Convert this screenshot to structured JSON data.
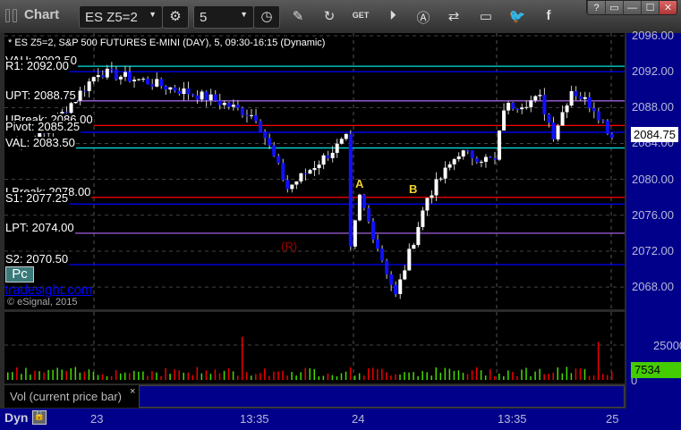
{
  "toolbar": {
    "title": "Chart",
    "symbol": "ES Z5=2",
    "interval": "5",
    "win_buttons": [
      "?",
      "▭",
      "—",
      "☐",
      "✕"
    ]
  },
  "chart": {
    "header": "* ES Z5=2, S&P 500 FUTURES E-MINI (DAY), 5, 09:30-16:15 (Dynamic)",
    "levels": [
      {
        "label": "VAH: 2092.50",
        "price": 2092.6,
        "color": "#00e5e5"
      },
      {
        "label": "R1: 2092.00",
        "price": 2092.0,
        "color": "#0000ff"
      },
      {
        "label": "UPT: 2088.75",
        "price": 2088.75,
        "color": "#a060e0"
      },
      {
        "label": "UBreak: 2086.00",
        "price": 2086.0,
        "color": "#ff0000"
      },
      {
        "label": "Pivot: 2085.25",
        "price": 2085.25,
        "color": "#0000ff"
      },
      {
        "label": "VAL: 2083.50",
        "price": 2083.5,
        "color": "#00e5e5"
      },
      {
        "label": "LBreak: 2078.00",
        "price": 2078.0,
        "color": "#ff0000"
      },
      {
        "label": "S1: 2077.25",
        "price": 2077.25,
        "color": "#0000ff"
      },
      {
        "label": "LPT: 2074.00",
        "price": 2074.0,
        "color": "#a060e0"
      },
      {
        "label": "S2: 2070.50",
        "price": 2070.5,
        "color": "#0000ff"
      }
    ],
    "price_ticks": [
      "2096.00",
      "2092.00",
      "2088.00",
      "2084.00",
      "2080.00",
      "2076.00",
      "2072.00",
      "2068.00"
    ],
    "last_price": "2084.75",
    "pc_label": "Pc",
    "link": "tradesight.com",
    "copyright": "© eSignal, 2015",
    "annotations": {
      "a": "A",
      "b": "B",
      "r": "(R)"
    },
    "chart_data": {
      "type": "candlestick",
      "ylim": [
        2066,
        2097
      ],
      "keyframes": [
        [
          0,
          2084
        ],
        [
          8,
          2085
        ],
        [
          20,
          2092
        ],
        [
          30,
          2091
        ],
        [
          45,
          2089
        ],
        [
          55,
          2087
        ],
        [
          62,
          2079
        ],
        [
          75,
          2084.5
        ],
        [
          76,
          2072
        ],
        [
          78,
          2078
        ],
        [
          86,
          2067
        ],
        [
          93,
          2078
        ],
        [
          100,
          2083
        ],
        [
          108,
          2082
        ],
        [
          110,
          2088
        ],
        [
          118,
          2089
        ],
        [
          121,
          2085
        ],
        [
          125,
          2090
        ],
        [
          130,
          2088
        ],
        [
          134,
          2084.75
        ]
      ]
    }
  },
  "volume": {
    "label": "Vol (current price bar)",
    "close": "×",
    "ticks": [
      "25000",
      "0"
    ],
    "last": "7534"
  },
  "xaxis": {
    "mode": "Dyn",
    "labels": [
      "23",
      "13:35",
      "24",
      "13:35",
      "25"
    ]
  }
}
